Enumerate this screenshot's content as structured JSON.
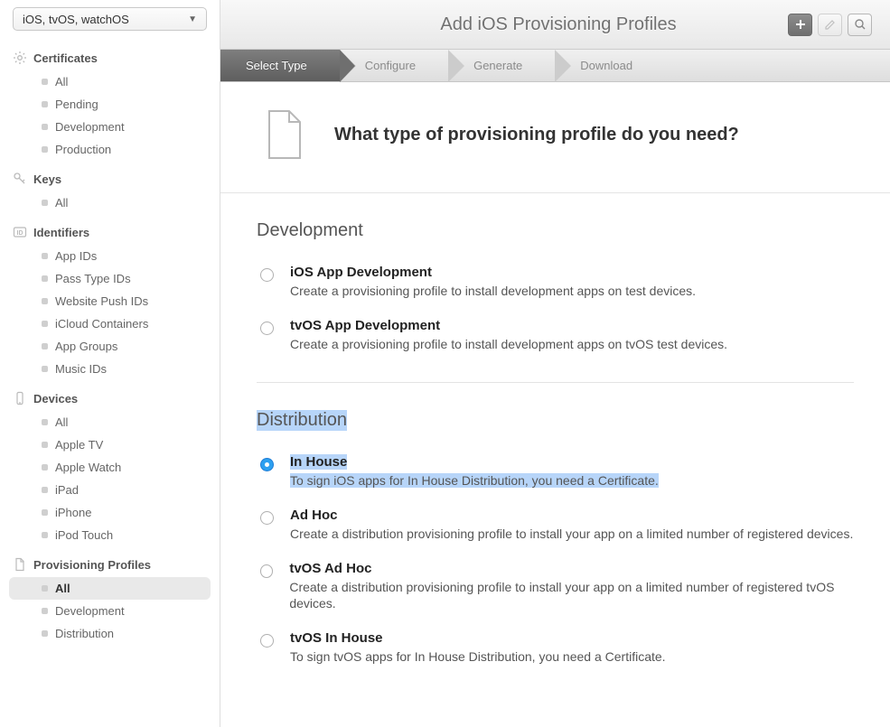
{
  "platform_selector": "iOS, tvOS, watchOS",
  "sidebar": {
    "certificates": {
      "label": "Certificates",
      "items": [
        "All",
        "Pending",
        "Development",
        "Production"
      ]
    },
    "keys": {
      "label": "Keys",
      "items": [
        "All"
      ]
    },
    "identifiers": {
      "label": "Identifiers",
      "items": [
        "App IDs",
        "Pass Type IDs",
        "Website Push IDs",
        "iCloud Containers",
        "App Groups",
        "Music IDs"
      ]
    },
    "devices": {
      "label": "Devices",
      "items": [
        "All",
        "Apple TV",
        "Apple Watch",
        "iPad",
        "iPhone",
        "iPod Touch"
      ]
    },
    "provisioning": {
      "label": "Provisioning Profiles",
      "items": [
        "All",
        "Development",
        "Distribution"
      ],
      "active": "All"
    }
  },
  "titlebar": {
    "title": "Add iOS Provisioning Profiles"
  },
  "steps": [
    "Select Type",
    "Configure",
    "Generate",
    "Download"
  ],
  "active_step": "Select Type",
  "prompt": "What type of provisioning profile do you need?",
  "groups": [
    {
      "title": "Development",
      "highlighted": false,
      "options": [
        {
          "title": "iOS App Development",
          "desc": "Create a provisioning profile to install development apps on test devices.",
          "checked": false,
          "highlighted": false
        },
        {
          "title": "tvOS App Development",
          "desc": "Create a provisioning profile to install development apps on tvOS test devices.",
          "checked": false,
          "highlighted": false
        }
      ]
    },
    {
      "title": "Distribution",
      "highlighted": true,
      "options": [
        {
          "title": "In House",
          "desc": "To sign iOS apps for In House Distribution, you need a Certificate.",
          "checked": true,
          "highlighted": true
        },
        {
          "title": "Ad Hoc",
          "desc": "Create a distribution provisioning profile to install your app on a limited number of registered devices.",
          "checked": false,
          "highlighted": false
        },
        {
          "title": "tvOS Ad Hoc",
          "desc": "Create a distribution provisioning profile to install your app on a limited number of registered tvOS devices.",
          "checked": false,
          "highlighted": false
        },
        {
          "title": "tvOS In House",
          "desc": "To sign tvOS apps for In House Distribution, you need a Certificate.",
          "checked": false,
          "highlighted": false
        }
      ]
    }
  ]
}
